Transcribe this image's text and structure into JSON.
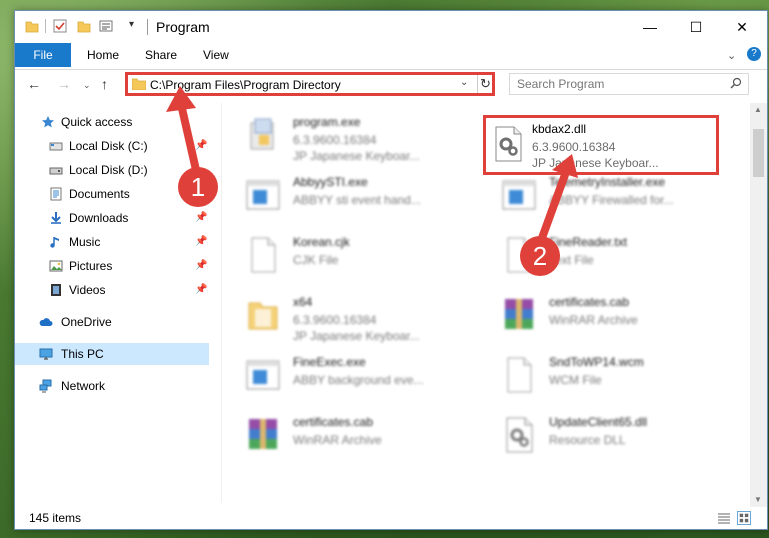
{
  "window": {
    "title": "Program",
    "min_symbol": "—",
    "max_symbol": "☐",
    "close_symbol": "✕"
  },
  "ribbon": {
    "tabs": [
      "File",
      "Home",
      "Share",
      "View"
    ],
    "expand_symbol": "⌄",
    "help_symbol": "?"
  },
  "nav": {
    "back_symbol": "←",
    "forward_symbol": "→",
    "recent_symbol": "⌄",
    "up_symbol": "↑",
    "address": "C:\\Program Files\\Program Directory",
    "address_dropdown": "⌄",
    "refresh_symbol": "↻",
    "search_placeholder": "Search Program"
  },
  "sidebar": {
    "items": [
      {
        "label": "Quick access",
        "icon": "star-icon",
        "pinned": false
      },
      {
        "label": "Local Disk (C:)",
        "icon": "drive-icon",
        "pinned": true
      },
      {
        "label": "Local Disk (D:)",
        "icon": "drive-icon",
        "pinned": false
      },
      {
        "label": "Documents",
        "icon": "documents-icon",
        "pinned": true
      },
      {
        "label": "Downloads",
        "icon": "download-icon",
        "pinned": true
      },
      {
        "label": "Music",
        "icon": "music-icon",
        "pinned": true
      },
      {
        "label": "Pictures",
        "icon": "pictures-icon",
        "pinned": true
      },
      {
        "label": "Videos",
        "icon": "videos-icon",
        "pinned": true
      },
      {
        "label": "OneDrive",
        "icon": "cloud-icon",
        "pinned": false
      },
      {
        "label": "This PC",
        "icon": "pc-icon",
        "pinned": false,
        "selected": true
      },
      {
        "label": "Network",
        "icon": "network-icon",
        "pinned": false
      }
    ],
    "pin_symbol": "📌"
  },
  "files": [
    {
      "name": "program.exe",
      "line1": "6.3.9600.16384",
      "line2": "JP Japanese Keyboar...",
      "icon": "installer-icon",
      "highlight": false
    },
    {
      "name": "kbdax2.dll",
      "line1": "6.3.9600.16384",
      "line2": "JP Japanese Keyboar...",
      "icon": "dll-gear-icon",
      "highlight": true
    },
    {
      "name": "AbbyySTI.exe",
      "line1": "ABBYY sti event hand...",
      "line2": "",
      "icon": "app-window-icon",
      "highlight": false
    },
    {
      "name": "TelemetryInstaller.exe",
      "line1": "ABBYY Firewalled for...",
      "line2": "",
      "icon": "app-window-icon",
      "highlight": false
    },
    {
      "name": "Korean.cjk",
      "line1": "CJK File",
      "line2": "",
      "icon": "blank-file-icon",
      "highlight": false
    },
    {
      "name": "FineReader.txt",
      "line1": "Text File",
      "line2": "",
      "icon": "blank-file-icon",
      "highlight": false
    },
    {
      "name": "x64",
      "line1": "6.3.9600.16384",
      "line2": "JP Japanese Keyboar...",
      "icon": "folder-icon",
      "highlight": false
    },
    {
      "name": "certificates.cab",
      "line1": "WinRAR Archive",
      "line2": "",
      "icon": "winrar-icon",
      "highlight": false
    },
    {
      "name": "FineExec.exe",
      "line1": "ABBY background eve...",
      "line2": "",
      "icon": "app-window-icon",
      "highlight": false
    },
    {
      "name": "SndToWP14.wcm",
      "line1": "WCM File",
      "line2": "",
      "icon": "blank-file-icon",
      "highlight": false
    },
    {
      "name": "certificates.cab",
      "line1": "WinRAR Archive",
      "line2": "",
      "icon": "winrar-icon",
      "highlight": false
    },
    {
      "name": "UpdateClient65.dll",
      "line1": "Resource DLL",
      "line2": "",
      "icon": "dll-gear-icon",
      "highlight": false
    }
  ],
  "status": {
    "item_count": "145 items"
  },
  "annotations": {
    "badge1": "1",
    "badge2": "2",
    "color": "#e0403a"
  }
}
